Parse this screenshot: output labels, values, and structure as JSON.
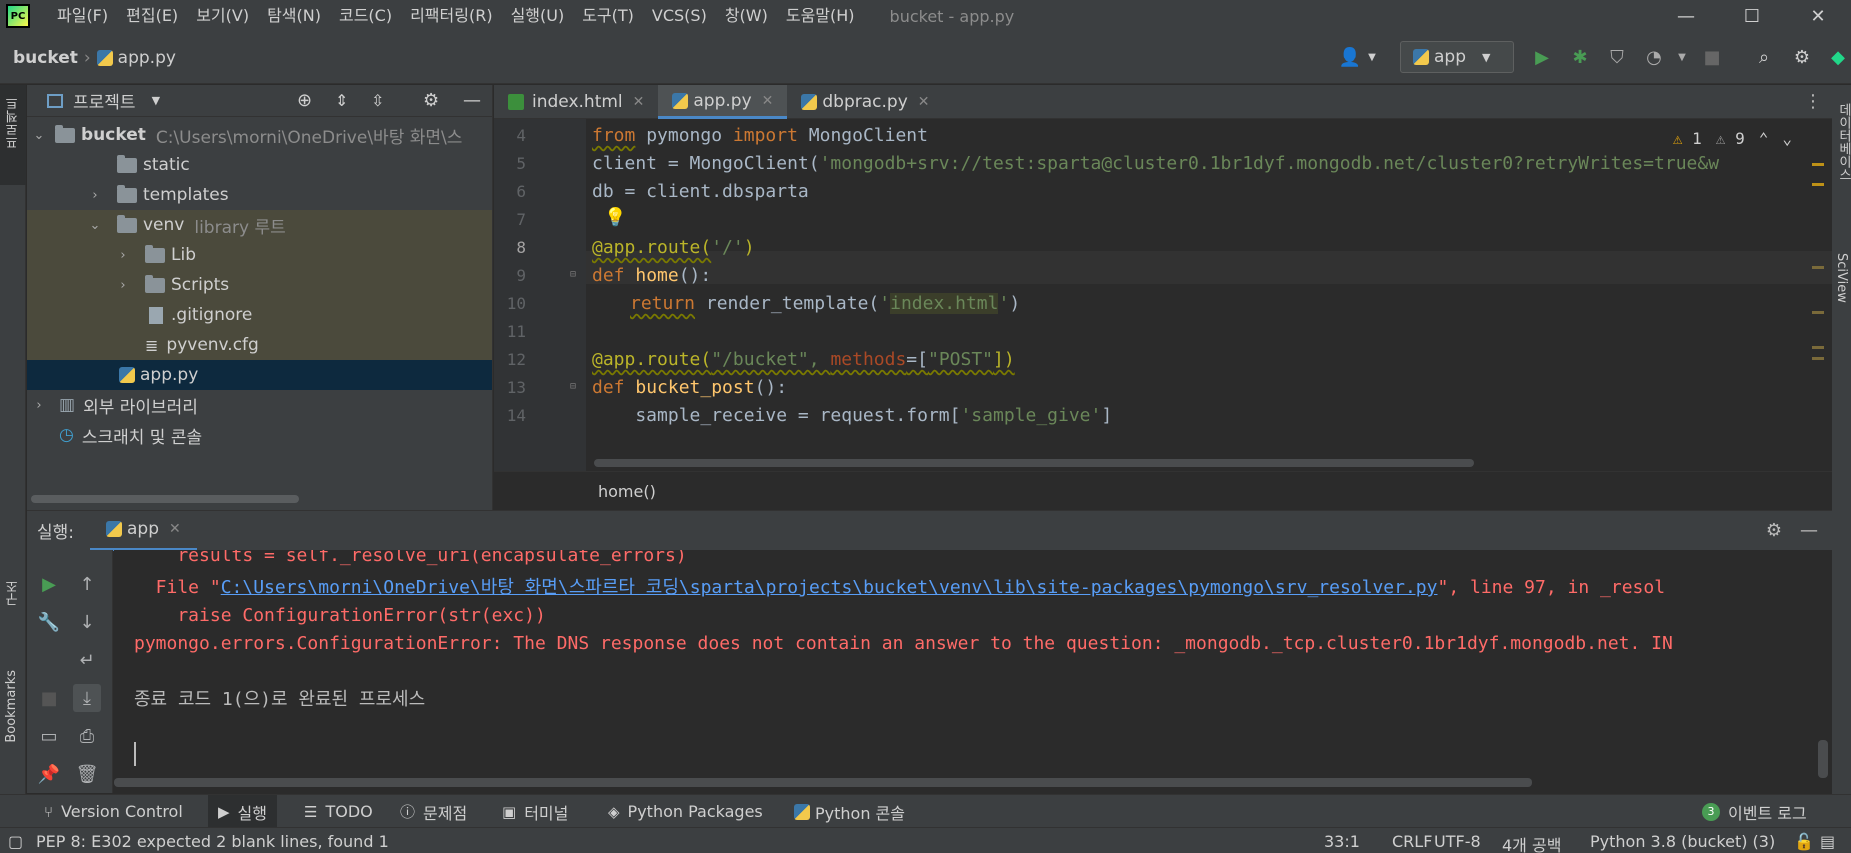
{
  "menubar": {
    "logo_text": "PC",
    "items": [
      "파일(F)",
      "편집(E)",
      "보기(V)",
      "탐색(N)",
      "코드(C)",
      "리팩터링(R)",
      "실행(U)",
      "도구(T)",
      "VCS(S)",
      "창(W)",
      "도움말(H)"
    ],
    "window_title": "bucket - app.py",
    "minimize": "—",
    "maximize": "☐",
    "close": "✕"
  },
  "navbar": {
    "project": "bucket",
    "file": "app.py",
    "run_config": "app"
  },
  "left_stripe": {
    "project_label": "프로젝트",
    "structure_label": "구조",
    "bookmarks_label": "Bookmarks"
  },
  "right_stripe": {
    "database_label": "데이터베이스",
    "sciview_label": "SciView"
  },
  "project_panel": {
    "title": "프로젝트",
    "tree": [
      {
        "label": "bucket",
        "hint": "C:\\Users\\morni\\OneDrive\\바탕 화면\\스"
      },
      {
        "label": "static"
      },
      {
        "label": "templates"
      },
      {
        "label": "venv",
        "hint": "library 루트"
      },
      {
        "label": "Lib"
      },
      {
        "label": "Scripts"
      },
      {
        "label": ".gitignore"
      },
      {
        "label": "pyvenv.cfg"
      },
      {
        "label": "app.py"
      },
      {
        "label": "외부 라이브러리"
      },
      {
        "label": "스크래치 및 콘솔"
      }
    ]
  },
  "editor": {
    "tabs": [
      {
        "label": "index.html",
        "close": "✕"
      },
      {
        "label": "app.py",
        "close": "✕"
      },
      {
        "label": "dbprac.py",
        "close": "✕"
      }
    ],
    "line_numbers": [
      "4",
      "5",
      "6",
      "7",
      "8",
      "9",
      "10",
      "11",
      "12",
      "13",
      "14"
    ],
    "code": {
      "l4_kw1": "from",
      "l4_mod": " pymongo ",
      "l4_kw2": "import",
      "l4_rest": " MongoClient",
      "l5_pre": "client = MongoClient(",
      "l5_str": "'mongodb+srv://test:sparta@cluster0.1br1dyf.mongodb.net/cluster0?retryWrites=true&w",
      "l6": "db = client.dbsparta",
      "l8_dec": "@app.route(",
      "l8_str": "'/'",
      "l8_close": ")",
      "l9_kw": "def",
      "l9_fn": " home",
      "l9_rest": "():",
      "l10_kw": "return",
      "l10_mid": " render_template(",
      "l10_q1": "'",
      "l10_str": "index.html",
      "l10_q2": "'",
      "l10_close": ")",
      "l12_dec": "@app.route(",
      "l12_str": "\"/bucket\", ",
      "l12_param": "methods",
      "l12_eq": "=[",
      "l12_str2": "\"POST\"",
      "l12_close": "])",
      "l13_kw": "def",
      "l13_fn": " bucket_post",
      "l13_rest": "():",
      "l14_pre": "    sample_receive = request.form[",
      "l14_str": "'sample_give'",
      "l14_close": "]"
    },
    "warnings": "1",
    "weak_warnings": "9",
    "breadcrumb": "home()"
  },
  "run_panel": {
    "label": "실행:",
    "tab": "app",
    "tab_close": "✕",
    "console": {
      "l1": "    results = self._resolve_uri(encapsulate_errors)",
      "l2_pre": "  File \"",
      "l2_link": "C:\\Users\\morni\\OneDrive\\바탕 화면\\스파르타 코딩\\sparta\\projects\\bucket\\venv\\lib\\site-packages\\pymongo\\srv_resolver.py",
      "l2_post": "\", line 97, in _resol",
      "l3": "    raise ConfigurationError(str(exc))",
      "l4": "pymongo.errors.ConfigurationError: The DNS response does not contain an answer to the question: _mongodb._tcp.cluster0.1br1dyf.mongodb.net. IN",
      "l6": "종료 코드 1(으)로 완료된 프로세스"
    }
  },
  "bottom_tools": [
    {
      "label": "Version Control"
    },
    {
      "label": "실행"
    },
    {
      "label": "TODO"
    },
    {
      "label": "문제점"
    },
    {
      "label": "터미널"
    },
    {
      "label": "Python Packages"
    },
    {
      "label": "Python 콘솔"
    }
  ],
  "event_log": {
    "count": "3",
    "label": "이벤트 로그"
  },
  "status_bar": {
    "message": "PEP 8: E302 expected 2 blank lines, found 1",
    "position": "33:1",
    "line_sep": "CRLF",
    "encoding": "UTF-8",
    "indent": "4개 공백",
    "interpreter": "Python 3.8 (bucket) (3)"
  },
  "colors": {
    "accent": "#4a88c7",
    "run_green": "#499c54",
    "error_red": "#ff6b68",
    "link_blue": "#589df6"
  }
}
